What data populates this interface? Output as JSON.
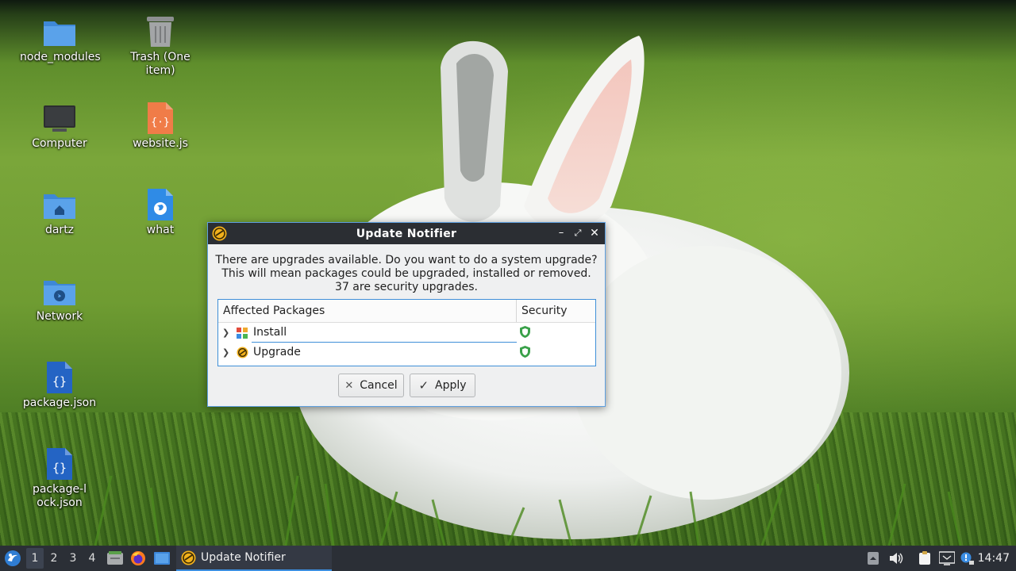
{
  "desktop": {
    "icons": [
      {
        "label": "node_modules",
        "icon": "folder-icon"
      },
      {
        "label": "Trash (One item)",
        "icon": "trash-icon"
      },
      {
        "label": "Computer",
        "icon": "computer-icon"
      },
      {
        "label": "website.js",
        "icon": "javascript-file-icon"
      },
      {
        "label": "dartz",
        "icon": "home-folder-icon"
      },
      {
        "label": "what",
        "icon": "web-file-icon"
      },
      {
        "label": "Network",
        "icon": "network-folder-icon"
      },
      {
        "label": "package.json",
        "icon": "json-file-icon"
      },
      {
        "label": "package-lock.json",
        "icon": "json-file-icon"
      }
    ]
  },
  "dialog": {
    "title": "Update Notifier",
    "message_line1": "There are upgrades available. Do you want to do a system upgrade?",
    "message_line2": "This will mean packages could be upgraded, installed or removed.",
    "message_line3": "37 are security upgrades.",
    "columns": [
      "Affected Packages",
      "Security"
    ],
    "rows": [
      {
        "label": "Install",
        "icon": "install-icon",
        "security": "shield-icon"
      },
      {
        "label": "Upgrade",
        "icon": "upgrade-icon",
        "security": "shield-icon"
      }
    ],
    "cancel_label": "Cancel",
    "apply_label": "Apply",
    "colors": {
      "titlebar": "#2b2e33",
      "accent": "#3f8fd8",
      "shield": "#3aa14a"
    }
  },
  "taskbar": {
    "workspaces": [
      "1",
      "2",
      "3",
      "4"
    ],
    "active_workspace": "1",
    "task_label": "Update Notifier",
    "clock": "14:47",
    "colors": {
      "background": "#2b2f36",
      "active_task": "#3d8ee0"
    }
  }
}
